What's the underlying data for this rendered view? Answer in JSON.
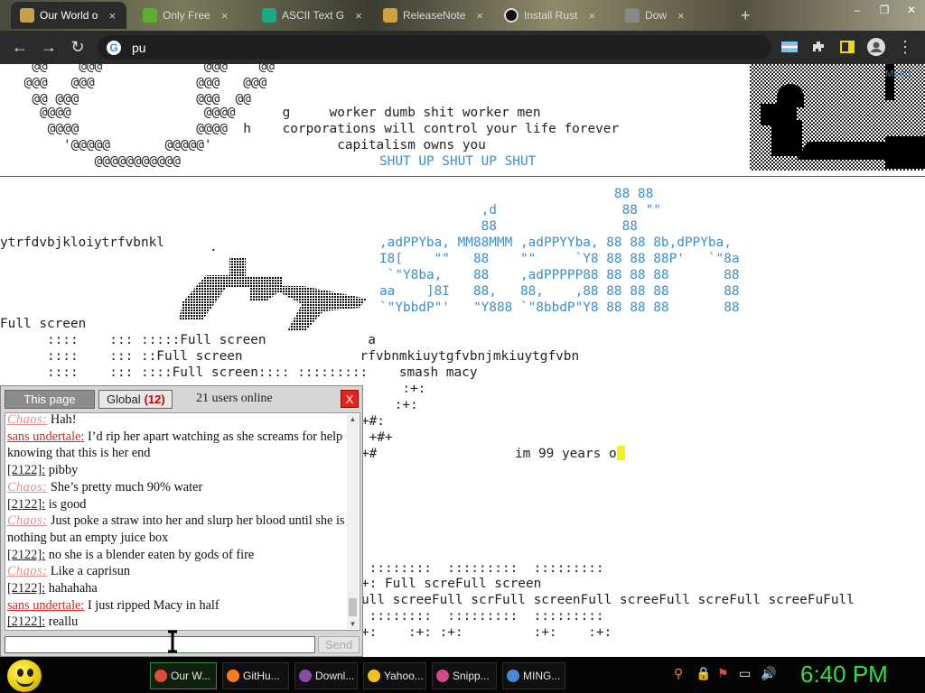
{
  "browser": {
    "tabs": [
      {
        "title": "Our World o",
        "color": "#c8a04a",
        "active": true
      },
      {
        "title": "Only Free",
        "color": "#5ab030",
        "active": false
      },
      {
        "title": "ASCII Text G",
        "color": "#1ba989",
        "active": false
      },
      {
        "title": "ReleaseNote",
        "color": "#d0a040",
        "active": false
      },
      {
        "title": "Install Rust",
        "color": "#333333",
        "active": false
      },
      {
        "title": "Dow",
        "color": "#888888",
        "active": false
      }
    ],
    "tab_close": "×",
    "new_tab": "+",
    "window_controls": {
      "minimize": "–",
      "maximize": "❐",
      "close": "✕"
    },
    "nav": {
      "back": "←",
      "forward": "→",
      "reload": "↻"
    },
    "omnibox_text": "pu",
    "menu_dots": "⋮"
  },
  "page": {
    "menu_label": "Menu",
    "top_art_lines": [
      "  @@    @@@             @@@    @@",
      " @@@   @@@             @@@   @@@",
      "  @@ @@@               @@@  @@",
      "   @@@@                 @@@@      g     worker dumb shit worker men",
      "    @@@@               @@@@  h    corporations will control your life forever",
      "      '@@@@@       @@@@@'                capitalism owns you"
    ],
    "top_art_last": "          @@@@@@@@@@@",
    "shut_up": "SHUT UP SHUT UP SHUT",
    "blue_art": [
      "                              88 88",
      "             ,d                88 \"\"",
      "             88                88",
      ",adPPYba, MM88MMM ,adPPYYba, 88 88 8b,dPPYba,",
      "I8[    \"\"   88    \"\"     `Y8 88 88 88P'   `\"8a",
      " `\"Y8ba,    88    ,adPPPPP88 88 88 88       88",
      "aa    ]8I   88,   88,    ,88 88 88 88       88",
      "`\"YbbdP\"'   \"Y888 `\"8bbdP\"Y8 88 88 88       88"
    ],
    "random_line": "ytrfdvbjkloiytrfvbnkl",
    "dot": ".",
    "full_screen_label": "Full screen",
    "mid_lines": [
      "      ::::    ::: :::::Full screen             a",
      "      ::::    ::: ::Full screen               rfvbnmkiuytgfvbnjmkiuytgfvbn",
      "      ::::    ::: ::::Full screen:::: :::::::::    smash macy"
    ],
    "right_lines": [
      "  :+:",
      " :+:",
      "+#:",
      " +#+",
      "+#"
    ],
    "old_text": "im 99 years o",
    "bottom_lines": [
      " ::::::::  :::::::::  :::::::::",
      "+: Full screFull screen",
      "ull screeFull scrFull screenFull screeFull screFull screeFuFull",
      " ::::::::  :::::::::  :::::::::",
      "+:    :+: :+:         :+:    :+:"
    ]
  },
  "chat": {
    "tab_this_page": "This page",
    "tab_global": "Global",
    "global_count": "(12)",
    "online": "21 users online",
    "close": "X",
    "messages": [
      {
        "user": "Chaos",
        "type": "chaos",
        "text": "Hah!"
      },
      {
        "user": "sans undertale",
        "type": "sans",
        "text": "I’d rip her apart watching as she screams for help knowing that this is her end"
      },
      {
        "user": "[2122]",
        "type": "num",
        "text": "pibby"
      },
      {
        "user": "Chaos",
        "type": "chaos",
        "text": "She’s pretty much 90% water"
      },
      {
        "user": "[2122]",
        "type": "num",
        "text": "is good"
      },
      {
        "user": "Chaos",
        "type": "chaos",
        "text": "Just poke a straw into her and slurp her blood until she is nothing but an empty juice box"
      },
      {
        "user": "[2122]",
        "type": "num",
        "text": "no she is a blender eaten by gods of fire"
      },
      {
        "user": "Chaos",
        "type": "chaos",
        "text": "Like a caprisun"
      },
      {
        "user": "[2122]",
        "type": "num",
        "text": "hahahaha"
      },
      {
        "user": "sans undertale",
        "type": "sans",
        "text": "I just ripped Macy in half"
      },
      {
        "user": "[2122]",
        "type": "num",
        "text": "reallu"
      }
    ],
    "input_value": "",
    "send": "Send"
  },
  "taskbar": {
    "items": [
      {
        "label": "Our W...",
        "color": "#e04a3a",
        "active": true
      },
      {
        "label": "GitHu...",
        "color": "#ff7a1a",
        "active": false
      },
      {
        "label": "Downl...",
        "color": "#8a4aa0",
        "active": false
      },
      {
        "label": "Yahoo...",
        "color": "#f2c21a",
        "active": false
      },
      {
        "label": "Snipp...",
        "color": "#d04a8a",
        "active": false
      },
      {
        "label": "MING...",
        "color": "#4a8ad0",
        "active": false
      }
    ],
    "tray": [
      "⚲",
      "🔒",
      "⚑",
      "▭",
      "🔊"
    ],
    "clock": "6:40 PM"
  }
}
